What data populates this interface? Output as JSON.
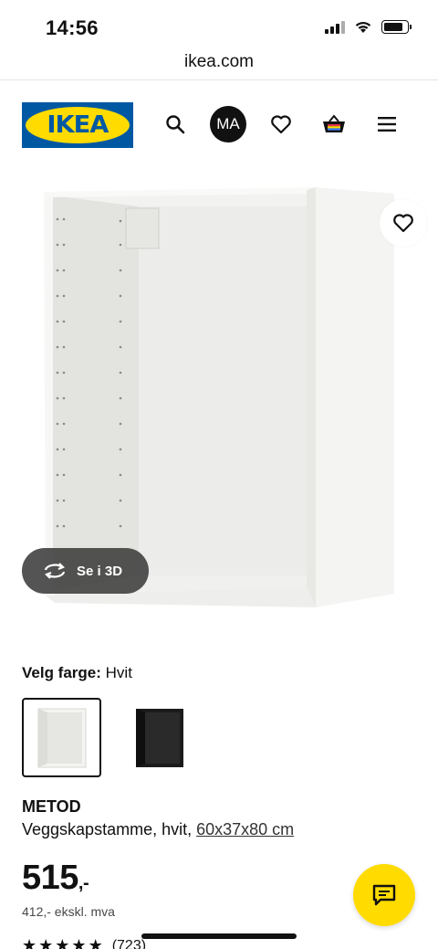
{
  "status_bar": {
    "time": "14:56",
    "battery_percent": 85
  },
  "browser": {
    "url": "ikea.com"
  },
  "header": {
    "logo_text": "IKEA",
    "avatar_initials": "MA",
    "icons": [
      "search-icon",
      "heart-icon",
      "cart-icon",
      "menu-icon"
    ]
  },
  "product_image": {
    "view_3d_label": "Se i 3D"
  },
  "color_selection": {
    "label": "Velg farge:",
    "selected_value": "Hvit",
    "swatches": [
      {
        "name": "Hvit",
        "color": "#f4f4f2",
        "selected": true
      },
      {
        "name": "Svart",
        "color": "#1b1b1b",
        "selected": false
      }
    ]
  },
  "product": {
    "name": "METOD",
    "description": "Veggskapstamme, hvit, ",
    "dimensions": "60x37x80 cm",
    "price_main": "515",
    "price_suffix": ",-",
    "price_excl_vat": "412,- ekskl. mva",
    "rating_stars": 4.5,
    "review_count": "(723)"
  },
  "colors": {
    "ikea_blue": "#0058a3",
    "ikea_yellow": "#ffdb00"
  }
}
